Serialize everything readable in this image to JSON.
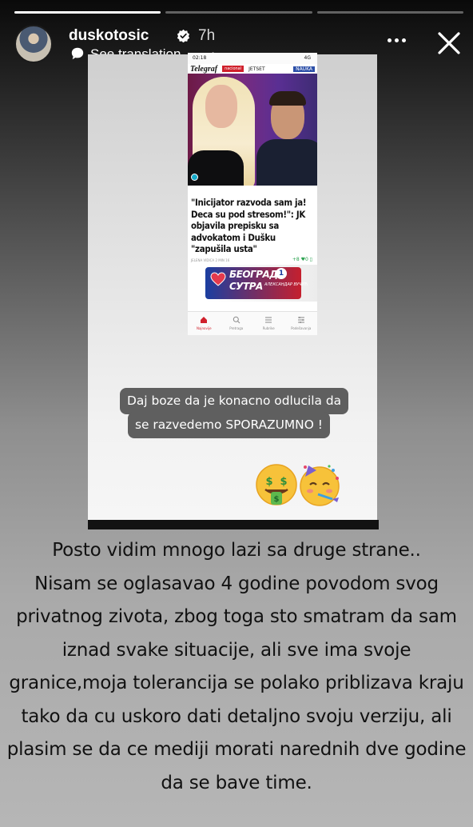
{
  "story": {
    "progress": [
      1.0,
      0.0,
      0.0
    ],
    "user": {
      "username": "duskotosic",
      "verified": true,
      "time": "7h"
    },
    "translate": {
      "label": "See translation",
      "chevron": "›"
    },
    "icons": {
      "more": "more-icon",
      "close": "close-icon",
      "verified": "verified-badge-icon",
      "translate": "speech-bubble-icon"
    }
  },
  "screenshot": {
    "status": {
      "time": "02:18",
      "right": "4G"
    },
    "site": {
      "logo": "Telegraf",
      "chip": "nacional",
      "nav": "JETSET",
      "section": "NAUKA"
    },
    "headline": "\"Inicijator razvoda sam ja! Deca su pod stresom!\": JK objavila prepisku sa advokatom i Dušku \"zapušila usta\"",
    "headline_lines": [
      "\"Inicijator razvoda sam ja!",
      "Deca su pod stresom!\": JK",
      "objavila prepisku sa",
      "advokatom i Dušku",
      "\"zapušila usta\""
    ],
    "meta_date": "JELENA VIDICA 2 MIN 16",
    "meta_stats": "+8 ♥0 ▯",
    "ad": {
      "line1": "БЕОГРАД",
      "line2": "СУТРА",
      "tag": "АЛЕКСАНДАР ВУЧИЋ",
      "badge": "1"
    },
    "tabs": [
      {
        "label": "Najnovije",
        "icon": "home-icon",
        "active": true
      },
      {
        "label": "Pretraga",
        "icon": "search-icon",
        "active": false
      },
      {
        "label": "Rubrike",
        "icon": "list-icon",
        "active": false
      },
      {
        "label": "Podešavanja",
        "icon": "settings-icon",
        "active": false
      }
    ]
  },
  "bubble": {
    "line1": "Daj boze da je konacno odlucila da",
    "line2": "se razvedemo SPORAZUMNO !"
  },
  "emojis": [
    "money-mouth-face",
    "partying-face"
  ],
  "caption": [
    "Posto vidim mnogo lazi sa druge strane..",
    "Nisam se oglasavao 4 godine povodom svog",
    "privatnog zivota, zbog toga sto smatram da sam",
    "iznad svake situacije, ali sve ima svoje",
    "granice,moja tolerancija se polako priblizava kraju",
    "tako da cu uskoro dati detaljno svoju verziju, ali",
    "plasim se da ce mediji morati narednih dve godine",
    "da se bave time."
  ]
}
